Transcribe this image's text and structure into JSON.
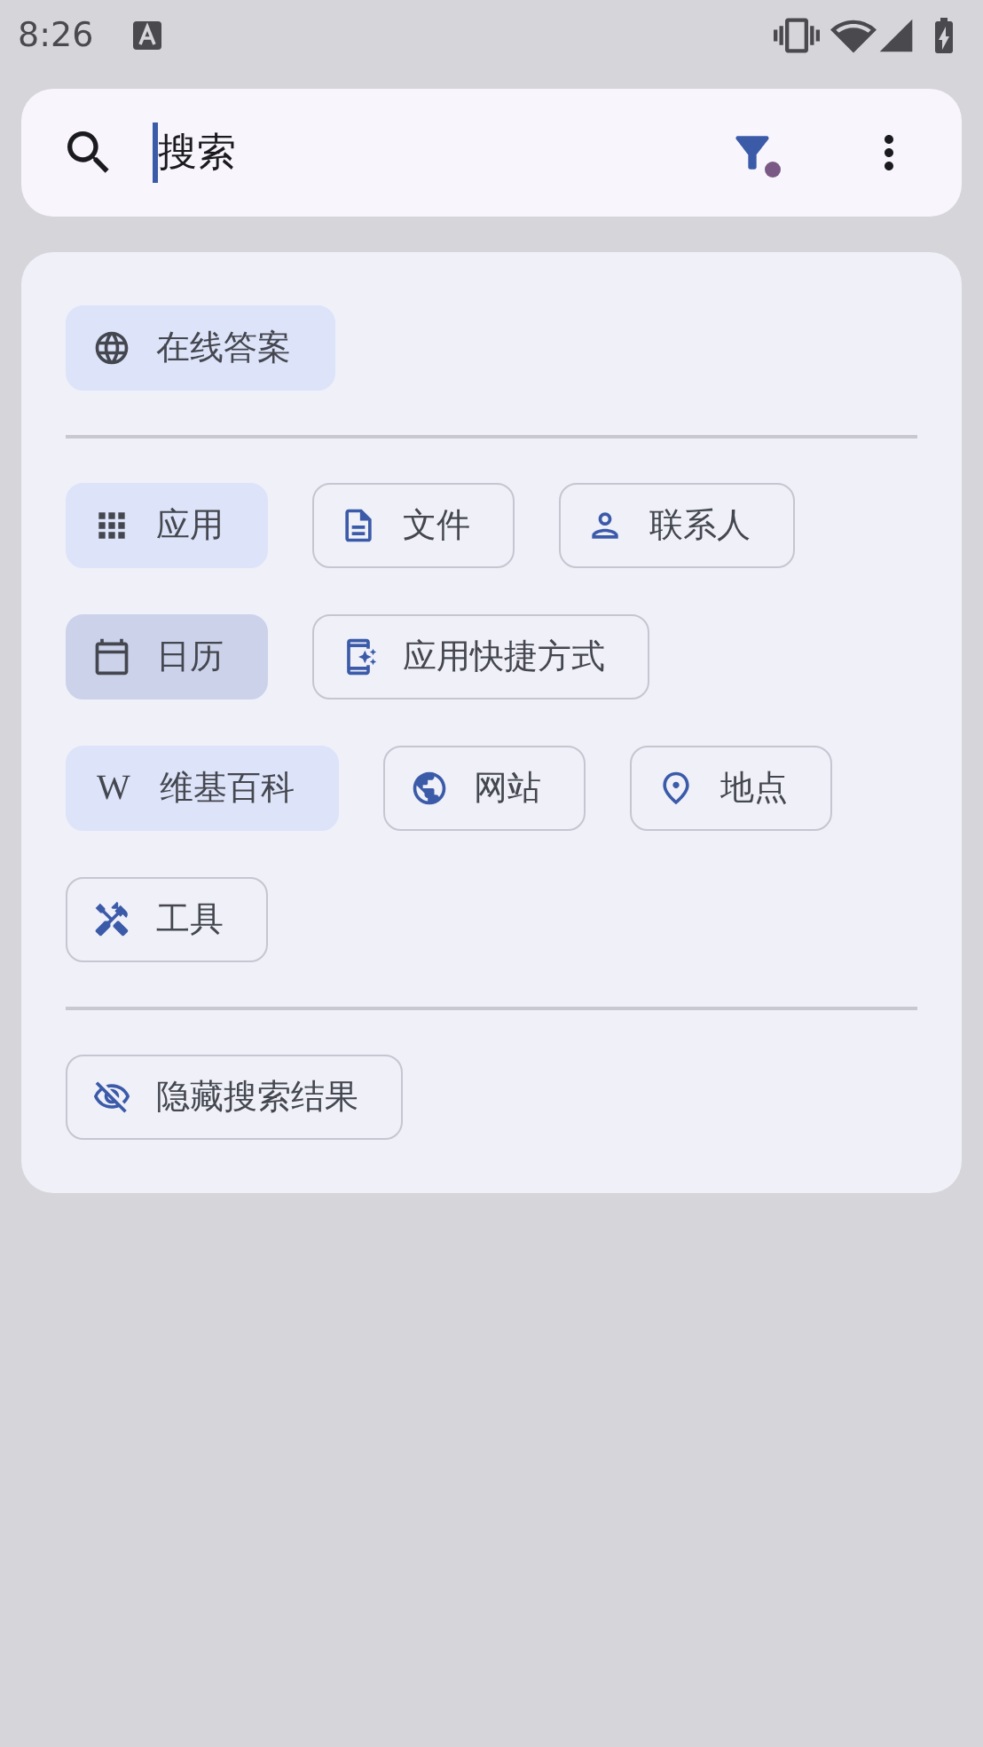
{
  "status_bar": {
    "time": "8:26"
  },
  "search": {
    "value": "搜索",
    "filter": {
      "active": true,
      "color": "#7a5a84"
    }
  },
  "sections": [
    {
      "chips": [
        {
          "kind": "globe",
          "label": "在线答案",
          "selected": true,
          "pressed": false
        }
      ]
    },
    {
      "chips": [
        {
          "kind": "apps",
          "label": "应用",
          "selected": true,
          "pressed": false
        },
        {
          "kind": "file",
          "label": "文件",
          "selected": false,
          "pressed": false
        },
        {
          "kind": "contact",
          "label": "联系人",
          "selected": false,
          "pressed": false
        },
        {
          "kind": "calendar",
          "label": "日历",
          "selected": true,
          "pressed": true
        },
        {
          "kind": "shortcut",
          "label": "应用快捷方式",
          "selected": false,
          "pressed": false
        },
        {
          "kind": "letter",
          "glyph": "W",
          "label": "维基百科",
          "selected": true,
          "pressed": false
        },
        {
          "kind": "web",
          "label": "网站",
          "selected": false,
          "pressed": false
        },
        {
          "kind": "place",
          "label": "地点",
          "selected": false,
          "pressed": false
        },
        {
          "kind": "tools",
          "label": "工具",
          "selected": false,
          "pressed": false
        }
      ]
    },
    {
      "chips": [
        {
          "kind": "hide",
          "label": "隐藏搜索结果",
          "selected": false,
          "pressed": false
        }
      ]
    }
  ]
}
